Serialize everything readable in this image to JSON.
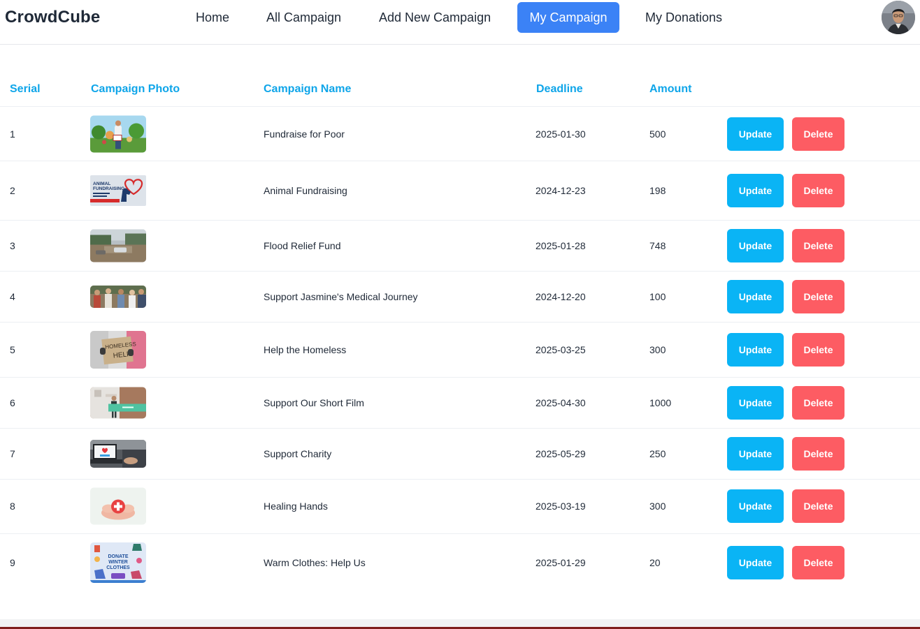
{
  "brand": "CrowdCube",
  "nav": {
    "items": [
      {
        "label": "Home",
        "active": false
      },
      {
        "label": "All Campaign",
        "active": false
      },
      {
        "label": "Add New Campaign",
        "active": false
      },
      {
        "label": "My Campaign",
        "active": true
      },
      {
        "label": "My Donations",
        "active": false
      }
    ],
    "accent_color": "#3b82f6"
  },
  "table": {
    "headers": {
      "serial": "Serial",
      "photo": "Campaign Photo",
      "name": "Campaign Name",
      "deadline": "Deadline",
      "amount": "Amount"
    },
    "header_color": "#0ea5e9",
    "update_label": "Update",
    "delete_label": "Delete",
    "update_color": "#0ab4f5",
    "delete_color": "#fd5c63",
    "rows": [
      {
        "serial": "1",
        "name": "Fundraise for Poor",
        "deadline": "2025-01-30",
        "amount": "500",
        "photo_theme": "volunteers-park"
      },
      {
        "serial": "2",
        "name": "Animal Fundraising",
        "deadline": "2024-12-23",
        "amount": "198",
        "photo_theme": "animal-fundraising-banner"
      },
      {
        "serial": "3",
        "name": "Flood Relief Fund",
        "deadline": "2025-01-28",
        "amount": "748",
        "photo_theme": "flooded-street"
      },
      {
        "serial": "4",
        "name": "Support Jasmine's Medical Journey",
        "deadline": "2024-12-20",
        "amount": "100",
        "photo_theme": "group-of-people"
      },
      {
        "serial": "5",
        "name": "Help the Homeless",
        "deadline": "2025-03-25",
        "amount": "300",
        "photo_theme": "homeless-cardboard-sign"
      },
      {
        "serial": "6",
        "name": "Support Our Short Film",
        "deadline": "2025-04-30",
        "amount": "1000",
        "photo_theme": "film-banner"
      },
      {
        "serial": "7",
        "name": "Support Charity",
        "deadline": "2025-05-29",
        "amount": "250",
        "photo_theme": "laptop-donation"
      },
      {
        "serial": "8",
        "name": "Healing Hands",
        "deadline": "2025-03-19",
        "amount": "300",
        "photo_theme": "hands-red-cross"
      },
      {
        "serial": "9",
        "name": "Warm Clothes: Help Us",
        "deadline": "2025-01-29",
        "amount": "20",
        "photo_theme": "winter-clothes-poster"
      }
    ]
  },
  "thumbnail_text": {
    "row2": [
      "ANIMAL",
      "FUNDRAISING"
    ],
    "row5": [
      "HOMELESS",
      "HELP"
    ],
    "row9": [
      "DONATE",
      "WINTER",
      "CLOTHES"
    ]
  }
}
